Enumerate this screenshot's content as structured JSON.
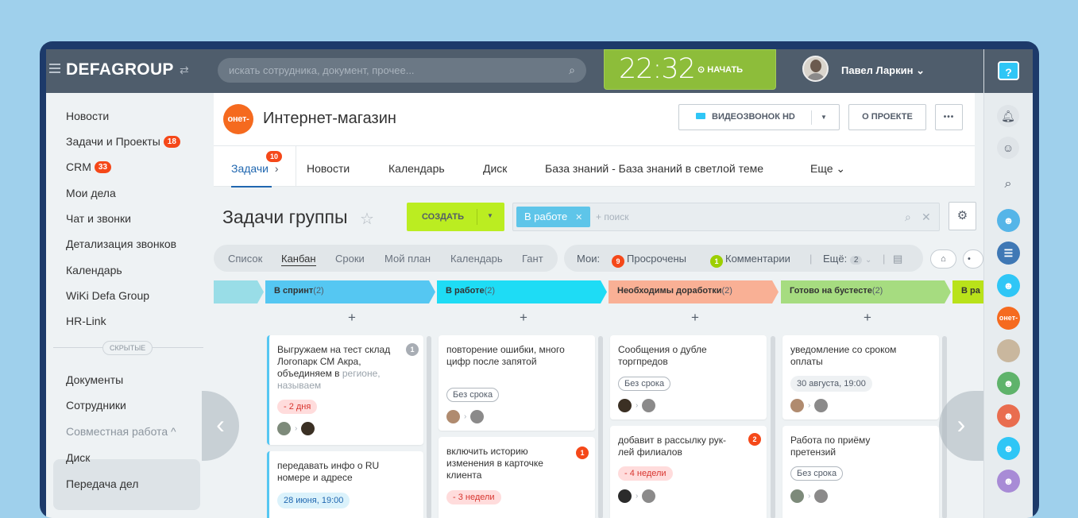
{
  "header": {
    "logo": "DEFAGROUP",
    "search_placeholder": "искать сотрудника, документ, прочее...",
    "time": "22:32",
    "start_label": "НАЧАТЬ",
    "user_name": "Павел Ларкин"
  },
  "sidebar": {
    "items": [
      {
        "label": "Новости"
      },
      {
        "label": "Задачи и Проекты",
        "count": "18"
      },
      {
        "label": "CRM",
        "count": "33"
      },
      {
        "label": "Мои дела"
      },
      {
        "label": "Чат и звонки"
      },
      {
        "label": "Детализация звонков"
      },
      {
        "label": "Календарь"
      },
      {
        "label": "WiKi Defa Group"
      },
      {
        "label": "HR-Link"
      }
    ],
    "hidden_label": "СКРЫТЫЕ",
    "hidden_items": [
      {
        "label": "Документы"
      },
      {
        "label": "Сотрудники"
      },
      {
        "label": "Совместная работа ^"
      },
      {
        "label": "Диск"
      },
      {
        "label": "Передача дел"
      }
    ]
  },
  "project": {
    "logo_text": "онет-",
    "title": "Интернет-магазин",
    "video_btn": "ВИДЕОЗВОНОК HD",
    "about_btn": "О ПРОЕКТЕ",
    "more_btn": "•••"
  },
  "tabs": [
    {
      "label": "Задачи",
      "count": "10",
      "suffix": "›"
    },
    {
      "label": "Новости"
    },
    {
      "label": "Календарь"
    },
    {
      "label": "Диск"
    },
    {
      "label": "База знаний - База знаний в светлой теме"
    },
    {
      "label": "Еще ⌄"
    }
  ],
  "toolbar": {
    "title": "Задачи группы",
    "create": "СОЗДАТЬ",
    "filter_chip": "В работе",
    "filter_search": "+ поиск"
  },
  "views": [
    "Список",
    "Канбан",
    "Сроки",
    "Мой план",
    "Календарь",
    "Гант"
  ],
  "mine": {
    "label": "Мои:",
    "overdue_count": "9",
    "overdue": "Просрочены",
    "comments_count": "1",
    "comments": "Комментарии",
    "more": "Ещё:",
    "more_count": "2"
  },
  "columns": [
    {
      "title": "В спринт",
      "count": "(2)",
      "color": "#55c7f2"
    },
    {
      "title": "В работе",
      "count": "(2)",
      "color": "#1edcf5"
    },
    {
      "title": "Необходимы доработки",
      "count": "(2)",
      "color": "#f9b095"
    },
    {
      "title": "Готово на бустесте",
      "count": "(2)",
      "color": "#a6dc80"
    },
    {
      "title": "В ра",
      "count": "",
      "color": "#b9e21a"
    }
  ],
  "cards": {
    "c1": {
      "title": "Выгружаем на тест склад Логопарк СМ Акра, объединяем в",
      "title_fade": "регионе, называем",
      "tag": "- 2 дня",
      "badge": "1"
    },
    "c2": {
      "title": "передавать инфо о RU номере и адресе",
      "tag": "28 июня, 19:00"
    },
    "c3": {
      "title": "повторение ошибки, много цифр после запятой",
      "tag": "Без срока"
    },
    "c4": {
      "title": "включить историю изменения в карточке клиента",
      "tag": "- 3 недели",
      "badge": "1"
    },
    "c5": {
      "title": "Сообщения о дубле торгпредов",
      "tag": "Без срока"
    },
    "c6": {
      "title": "добавит в рассылку рук-лей филиалов",
      "tag": "- 4 недели",
      "badge": "2"
    },
    "c7": {
      "title": "уведомление со сроком оплаты",
      "tag": "30 августа, 19:00"
    },
    "c8": {
      "title": "Работа по приёму претензий",
      "tag": "Без срока"
    }
  },
  "rightbar": {
    "help": "?",
    "avatar_text": "онет-"
  },
  "colors": {
    "topbar": "#4f5d6c",
    "accent_green": "#8dbd3a",
    "create_green": "#bbed21",
    "badge_red": "#f54819"
  }
}
